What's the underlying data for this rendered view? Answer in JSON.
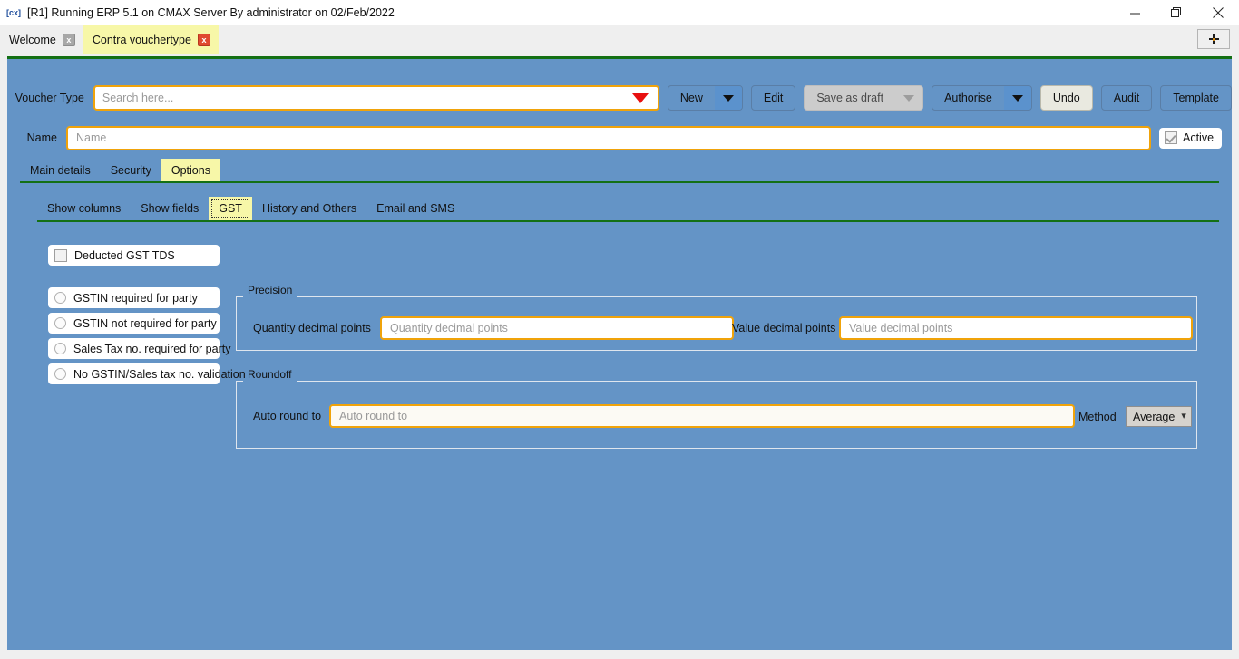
{
  "window": {
    "title": "[R1] Running ERP 5.1 on CMAX Server By administrator on 02/Feb/2022",
    "app_icon": "cmax-icon",
    "minimize_label": "Minimize",
    "maximize_label": "Restore",
    "close_label": "Close"
  },
  "doc_tabs": {
    "items": [
      {
        "label": "Welcome",
        "active": false,
        "close_label": "x"
      },
      {
        "label": "Contra vouchertype",
        "active": true,
        "close_label": "x"
      }
    ],
    "new_tab_label": "+"
  },
  "header": {
    "voucher_type_label": "Voucher Type",
    "voucher_type_value": "",
    "voucher_type_placeholder": "Search here...",
    "name_label": "Name",
    "name_value": "",
    "name_placeholder": "Name",
    "active_label": "Active",
    "active_checked": true
  },
  "toolbar": {
    "new_label": "New",
    "edit_label": "Edit",
    "save_as_draft_label": "Save as draft",
    "authorise_label": "Authorise",
    "undo_label": "Undo",
    "audit_label": "Audit",
    "template_label": "Template"
  },
  "primary_tabs": [
    {
      "label": "Main details",
      "active": false
    },
    {
      "label": "Security",
      "active": false
    },
    {
      "label": "Options",
      "active": true
    }
  ],
  "sub_tabs": [
    {
      "label": "Show columns",
      "active": false
    },
    {
      "label": "Show fields",
      "active": false
    },
    {
      "label": "GST",
      "active": true
    },
    {
      "label": "History and Others",
      "active": false
    },
    {
      "label": "Email and SMS",
      "active": false
    }
  ],
  "options": {
    "deducted_gst_tds": {
      "label": "Deducted GST TDS",
      "checked": false
    },
    "validation_choices": [
      {
        "label": "GSTIN required for party",
        "selected": false
      },
      {
        "label": "GSTIN not required for party",
        "selected": false
      },
      {
        "label": "Sales Tax no. required for party",
        "selected": false
      },
      {
        "label": "No GSTIN/Sales tax no. validation",
        "selected": false
      }
    ]
  },
  "precision": {
    "caption": "Precision",
    "quantity_label": "Quantity decimal points",
    "quantity_value": "",
    "quantity_placeholder": "Quantity decimal points",
    "value_label": "Value decimal points",
    "value_value": "",
    "value_placeholder": "Value decimal points"
  },
  "roundoff": {
    "caption": "Roundoff",
    "auto_round_label": "Auto round to",
    "auto_round_value": "",
    "auto_round_placeholder": "Auto round to",
    "method_label": "Method",
    "method_value": "Average"
  },
  "colors": {
    "content_bg": "#6494c6",
    "accent_border": "#f0a30a",
    "active_tab_bg": "#f7f7a8",
    "green_rule": "#147014",
    "close_red": "#e04a2f",
    "caret_red": "#e81010"
  }
}
